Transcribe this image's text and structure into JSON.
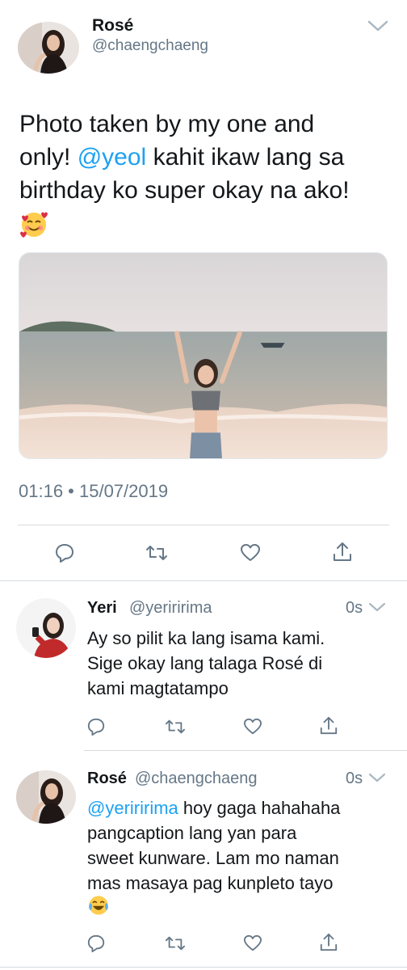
{
  "main_tweet": {
    "name": "Rosé",
    "handle": "@chaengchaeng",
    "text_lines": [
      "Photo taken by my one and",
      "kahit ikaw lang sa",
      "birthday ko super okay na ako!"
    ],
    "line2_prefix": "only! ",
    "mention": "@yeol",
    "emoji": "smiling-face-with-hearts",
    "timestamp": "01:16 • 15/07/2019"
  },
  "replies": [
    {
      "name": "Yeri",
      "handle": "@yeriririma",
      "time": "0s",
      "lines": [
        "Ay so pilit ka lang isama kami.",
        "Sige okay lang talaga Rosé di",
        "kami magtatampo"
      ]
    },
    {
      "name": "Rosé",
      "handle": "@chaengchaeng",
      "time": "0s",
      "mention": "@yeriririma",
      "line1_rest": " hoy gaga hahahaha",
      "lines": [
        "pangcaption lang yan para",
        "sweet kunware. Lam mo naman",
        "mas masaya pag kunpleto tayo"
      ],
      "emoji": "face-with-tears-of-joy"
    }
  ],
  "actions": [
    "reply",
    "retweet",
    "like",
    "share"
  ],
  "colors": {
    "link": "#1da1f2",
    "icon": "#657786",
    "text": "#14171a",
    "divider": "#d6dbdf"
  }
}
